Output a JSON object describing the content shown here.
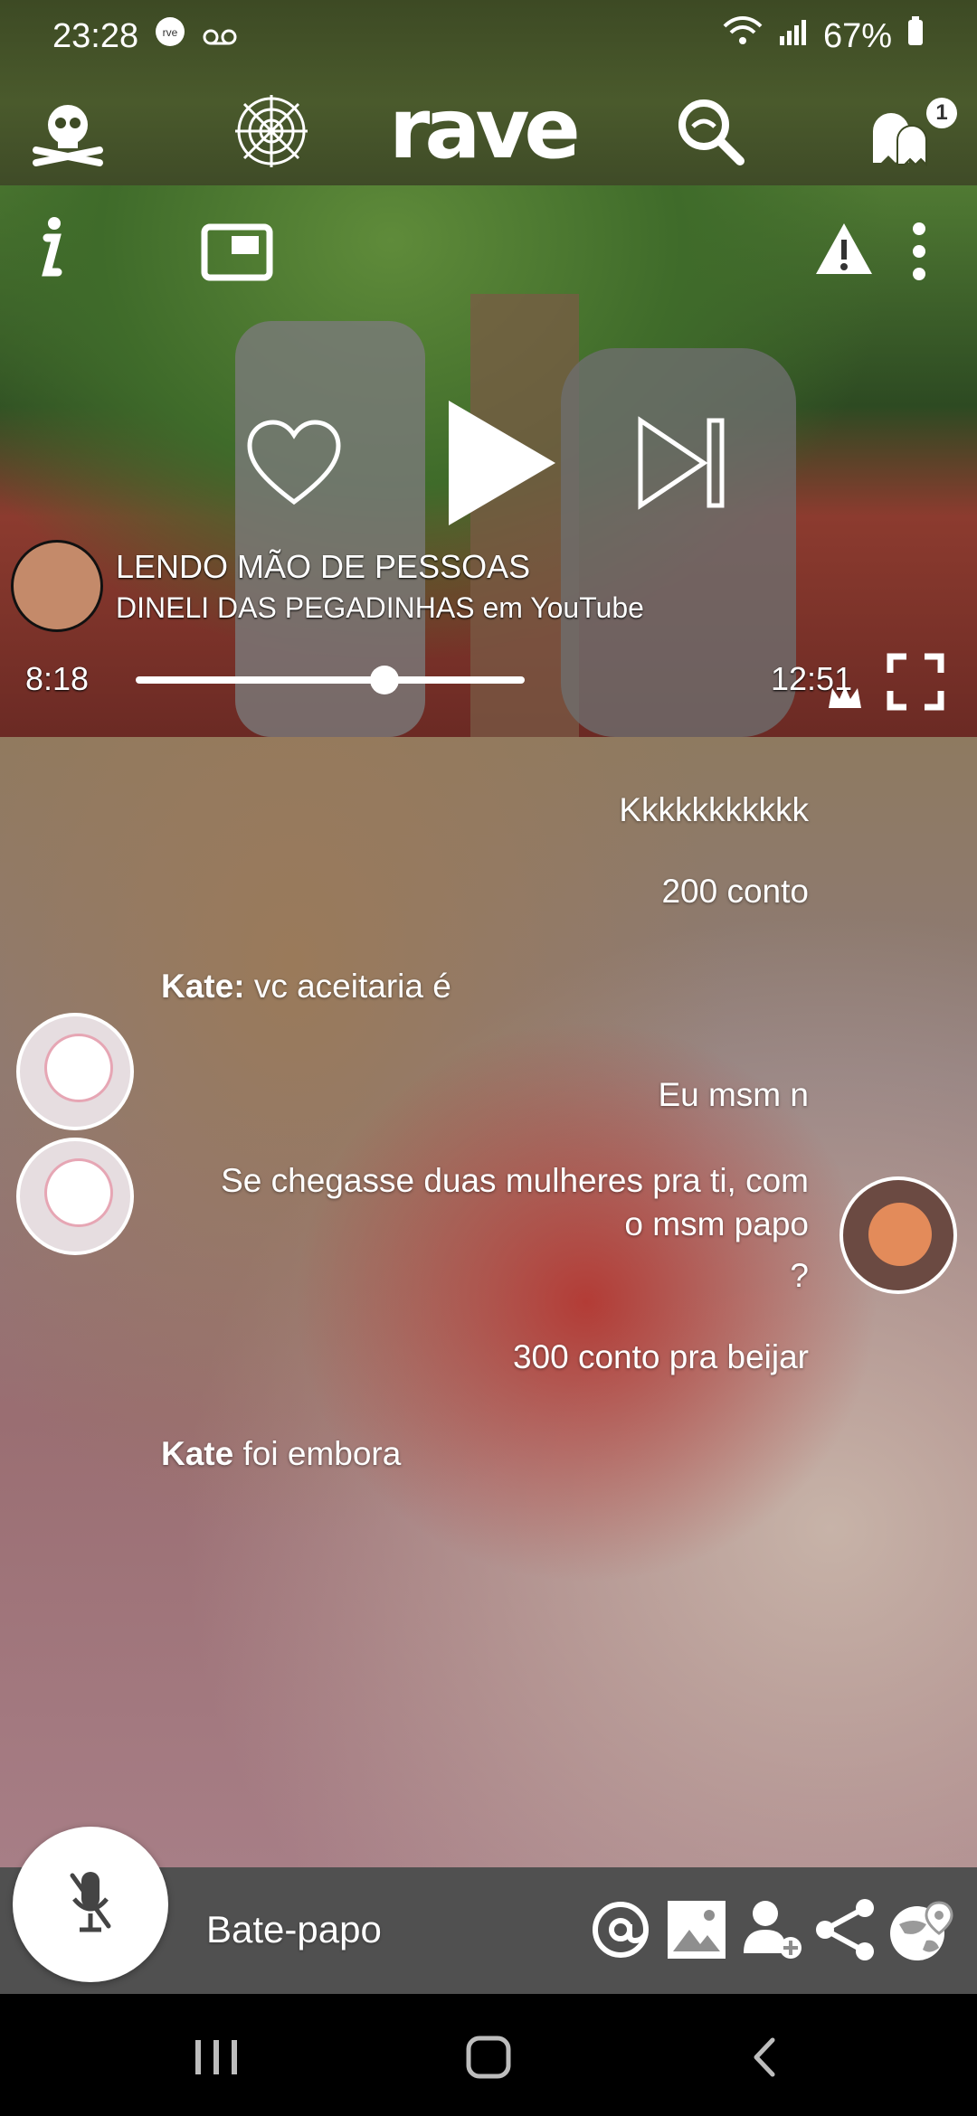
{
  "status_bar": {
    "time": "23:28",
    "battery": "67%",
    "icons": [
      "rave-notification-icon",
      "voicemail-icon",
      "wifi-icon",
      "signal-icon",
      "battery-icon"
    ]
  },
  "app_bar": {
    "brand": "rave",
    "icons": [
      "skull-icon",
      "spiderweb-icon",
      "search-icon",
      "ghost-friends-icon"
    ],
    "friends_badge": "1"
  },
  "video": {
    "title": "LENDO MÃO DE PESSOAS",
    "subtitle": "DINELI DAS PEGADINHAS em YouTube",
    "current_time": "8:18",
    "duration": "12:51",
    "progress_fraction": 0.64
  },
  "chat": {
    "messages": [
      {
        "text": "Kkkkkkkkkkk"
      },
      {
        "text": "200 conto"
      },
      {
        "user": "Kate:",
        "text": "vc aceitaria é"
      },
      {
        "text": "Eu msm n"
      },
      {
        "text": "Se chegasse duas mulheres pra ti, com"
      },
      {
        "text": "o msm papo"
      },
      {
        "text": "?"
      },
      {
        "text": "300 conto pra beijar"
      },
      {
        "user": "Kate",
        "text": "foi embora"
      }
    ]
  },
  "input": {
    "placeholder": "Bate-papo"
  },
  "colors": {
    "top_green": "#4a5a2c",
    "chat_red": "#b33c36"
  }
}
